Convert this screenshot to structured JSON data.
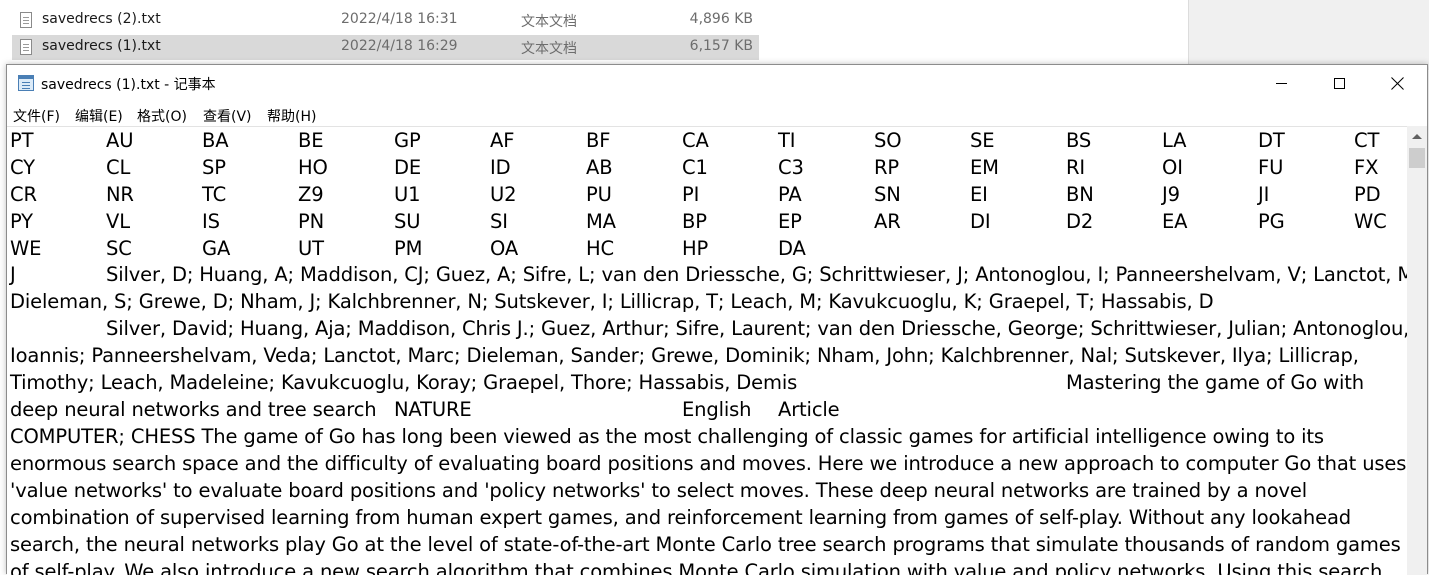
{
  "explorer": {
    "files": [
      {
        "name": "savedrecs (2).txt",
        "date": "2022/4/18 16:31",
        "type": "文本文档",
        "size": "4,896 KB"
      },
      {
        "name": "savedrecs (1).txt",
        "date": "2022/4/18 16:29",
        "type": "文本文档",
        "size": "6,157 KB"
      }
    ]
  },
  "window": {
    "title": "savedrecs (1).txt - 记事本"
  },
  "menu": {
    "file": "文件(F)",
    "edit": "编辑(E)",
    "format": "格式(O)",
    "view": "查看(V)",
    "help": "帮助(H)"
  },
  "content": {
    "header_rows": [
      [
        "PT",
        "AU",
        "BA",
        "BE",
        "GP",
        "AF",
        "BF",
        "CA",
        "TI",
        "SO",
        "SE",
        "BS",
        "LA",
        "DT",
        "CT"
      ],
      [
        "CY",
        "CL",
        "SP",
        "HO",
        "DE",
        "ID",
        "AB",
        "C1",
        "C3",
        "RP",
        "EM",
        "RI",
        "OI",
        "FU",
        "FX"
      ],
      [
        "CR",
        "NR",
        "TC",
        "Z9",
        "U1",
        "U2",
        "PU",
        "PI",
        "PA",
        "SN",
        "EI",
        "BN",
        "J9",
        "JI",
        "PD"
      ],
      [
        "PY",
        "VL",
        "IS",
        "PN",
        "SU",
        "SI",
        "MA",
        "BP",
        "EP",
        "AR",
        "DI",
        "D2",
        "EA",
        "PG",
        "WC"
      ],
      [
        "WE",
        "SC",
        "GA",
        "UT",
        "PM",
        "OA",
        "HC",
        "HP",
        "DA"
      ]
    ],
    "rec_type": "J",
    "authors_1": "Silver, D; Huang, A; Maddison, CJ; Guez, A; Sifre, L; van den Driessche, G; Schrittwieser, J; Antonoglou, I; Panneershelvam, V; Lanctot, M;",
    "authors_2": "Dieleman, S; Grewe, D; Nham, J; Kalchbrenner, N; Sutskever, I; Lillicrap, T; Leach, M; Kavukcuoglu, K; Graepel, T; Hassabis, D",
    "fullnames_1": "Silver, David; Huang, Aja; Maddison, Chris J.; Guez, Arthur; Sifre, Laurent; van den Driessche, George; Schrittwieser, Julian; Antonoglou,",
    "fullnames_2": "Ioannis; Panneershelvam, Veda; Lanctot, Marc; Dieleman, Sander; Grewe, Dominik; Nham, John; Kalchbrenner, Nal; Sutskever, Ilya; Lillicrap,",
    "fullnames_3": "Timothy; Leach, Madeleine; Kavukcuoglu, Koray; Graepel, Thore; Hassabis, Demis",
    "title_1": "Mastering the game of Go with",
    "title_2": "deep neural networks and tree search",
    "journal": "NATURE",
    "language": "English",
    "doc_type": "Article",
    "abstract_1": "COMPUTER; CHESS The game of Go has long been viewed as the most challenging of classic games for artificial intelligence owing to its",
    "abstract_2": "enormous search space and the difficulty of evaluating board positions and moves. Here we introduce a new approach to computer Go that uses",
    "abstract_3": "'value networks' to evaluate board positions and 'policy networks' to select moves. These deep neural networks are trained by a novel",
    "abstract_4": "combination of supervised learning from human expert games, and reinforcement learning from games of self-play. Without any lookahead",
    "abstract_5": "search, the neural networks play Go at the level of state-of-the-art Monte Carlo tree search programs that simulate thousands of random games",
    "abstract_6": "of self-play. We also introduce a new search algorithm that combines Monte Carlo simulation with value and policy networks. Using this search"
  }
}
